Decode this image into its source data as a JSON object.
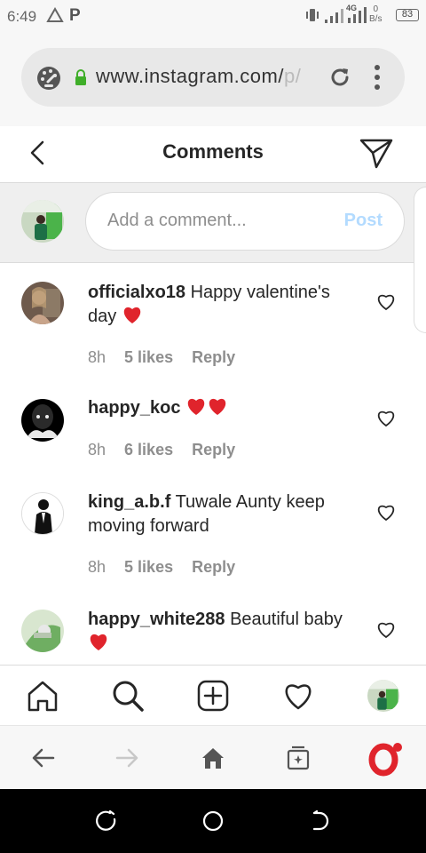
{
  "status": {
    "time": "6:49",
    "network_rate_value": "0",
    "network_rate_unit": "B/s",
    "network_type": "4G",
    "battery": "83"
  },
  "browser": {
    "url_main": "www.instagram.com/",
    "url_faded": "p/"
  },
  "header": {
    "title": "Comments"
  },
  "composer": {
    "placeholder": "Add a comment...",
    "post_label": "Post"
  },
  "comments": [
    {
      "username": "officialxo18",
      "text": "Happy valentine's day",
      "emoji": "heart",
      "time": "8h",
      "likes": "5 likes",
      "reply": "Reply"
    },
    {
      "username": "happy_koc",
      "text": "",
      "emoji": "two-hearts",
      "time": "8h",
      "likes": "6 likes",
      "reply": "Reply"
    },
    {
      "username": "king_a.b.f",
      "text": "Tuwale Aunty keep moving forward",
      "emoji": "",
      "time": "8h",
      "likes": "5 likes",
      "reply": "Reply"
    },
    {
      "username": "happy_white288",
      "text": "Beautiful baby",
      "emoji": "heart",
      "time": "",
      "likes": "",
      "reply": ""
    }
  ],
  "colors": {
    "post_disabled": "#b3dbff",
    "heart_red": "#e0242c",
    "opera_red": "#e0242c",
    "text_primary": "#262626",
    "text_secondary": "#8e8e8e"
  },
  "icons": {
    "ig_nav": [
      "home-icon",
      "search-icon",
      "new-post-icon",
      "activity-heart-icon",
      "profile-avatar"
    ],
    "browser_nav": [
      "back-arrow-icon",
      "forward-arrow-icon",
      "home-icon",
      "tabs-icon",
      "opera-menu-icon"
    ],
    "android_nav": [
      "recents-icon",
      "home-circle-icon",
      "back-icon"
    ]
  }
}
